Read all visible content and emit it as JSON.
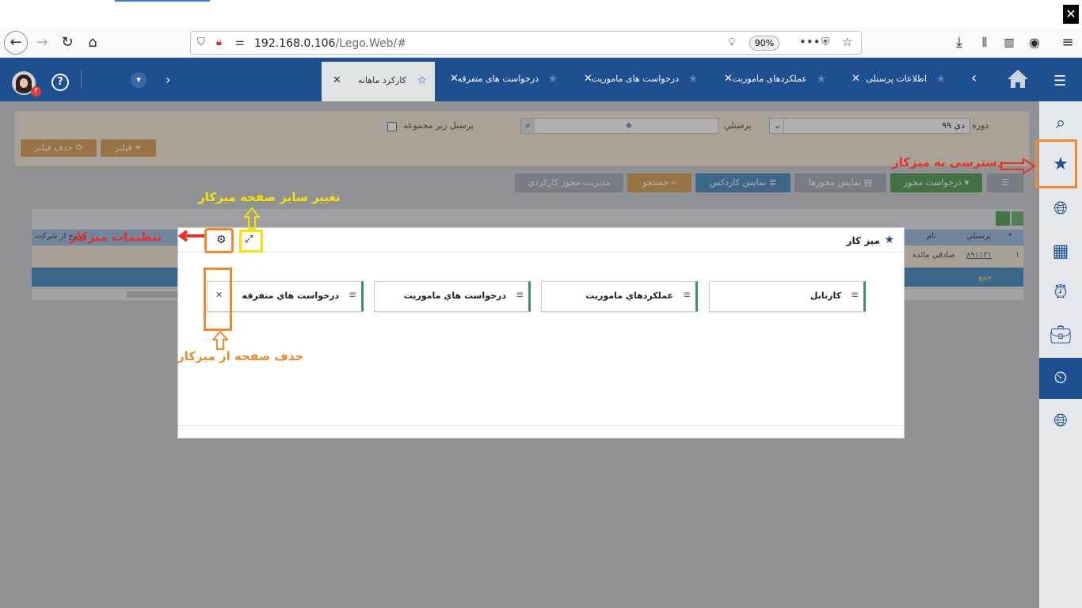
{
  "browser": {
    "url_host": "192.168.0.106",
    "url_path": "/Lego.Web/#",
    "zoom": "90%"
  },
  "header": {
    "notification_count": "۲",
    "help": "?",
    "tabs": [
      {
        "label": "اطلاعات پرسنلی"
      },
      {
        "label": "عملکردهای ماموریت"
      },
      {
        "label": "درخواست های ماموریت"
      },
      {
        "label": "درخواست های متفرقه"
      },
      {
        "label": "کارکرد ماهانه",
        "active": true
      }
    ]
  },
  "filters": {
    "period_label": "دوره",
    "period_value": "دي ۹۹",
    "personnel_label": "پرسنلي",
    "subset_label": "پرسنل زير مجموعه",
    "filter_button": "فيلتر",
    "remove_filter_button": "حذف فيلتر"
  },
  "actions": {
    "request_permit": "درخواست مجوز",
    "show_permits": "نمايش مجوزها",
    "show_cardex": "نمايش كاردكس",
    "search": "جستجو",
    "manage_permits": "مديريت مجوز كاركردي"
  },
  "grid": {
    "headers": [
      "*",
      "پرسنلي",
      "نام",
      "خروج از شركت"
    ],
    "row_index": "۱",
    "row_code": "۸۹۱۱۳۱",
    "row_name": "صادقي مائده",
    "total_label": "جمع"
  },
  "modal": {
    "title": "ميز كار",
    "cards": [
      {
        "title": "كارتابل"
      },
      {
        "title": "عملكردهاي ماموريت"
      },
      {
        "title": "درخواست هاي ماموريت"
      },
      {
        "title": "درخواست هاي متفرقه"
      }
    ]
  },
  "annotations": {
    "access_desk": "دسترسی به میزکار",
    "resize_desk": "تغییر سایز صفحه میزکار",
    "desk_settings": "تنظیمات میزکار",
    "remove_page": "حذف صفحه از میزکار"
  },
  "colors": {
    "header_blue": "#1d4f91",
    "annotation_orange": "#f08a2c",
    "annotation_yellow": "#f5e400",
    "annotation_red": "#e8312b"
  }
}
